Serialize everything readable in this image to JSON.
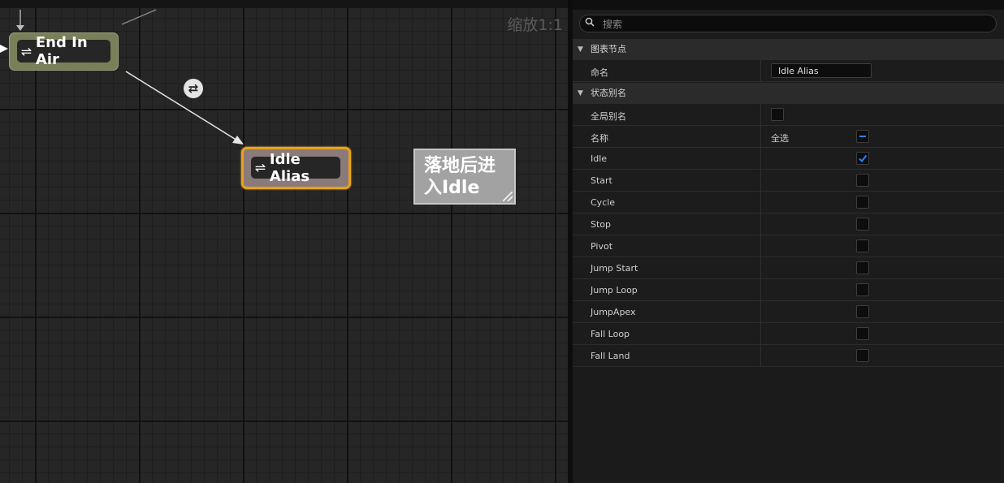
{
  "graph": {
    "zoom_label": "缩放1:1",
    "nodes": {
      "end_in_air": "End In Air",
      "idle_alias": "Idle Alias"
    },
    "comment": "落地后进入Idle"
  },
  "panel": {
    "search_placeholder": "搜索",
    "sections": {
      "graph_node": "图表节点",
      "state_alias": "状态别名"
    },
    "name_label": "命名",
    "name_value": "Idle Alias",
    "global_alias_label": "全局别名",
    "names_label": "名称",
    "select_all_label": "全选",
    "states": [
      {
        "name": "Idle",
        "checked": true
      },
      {
        "name": "Start",
        "checked": false
      },
      {
        "name": "Cycle",
        "checked": false
      },
      {
        "name": "Stop",
        "checked": false
      },
      {
        "name": "Pivot",
        "checked": false
      },
      {
        "name": "Jump Start",
        "checked": false
      },
      {
        "name": "Jump Loop",
        "checked": false
      },
      {
        "name": "JumpApex",
        "checked": false
      },
      {
        "name": "Fall Loop",
        "checked": false
      },
      {
        "name": "Fall Land",
        "checked": false
      }
    ]
  },
  "colors": {
    "selection_outline": "#e8a21a",
    "check_accent": "#2a84ff"
  }
}
